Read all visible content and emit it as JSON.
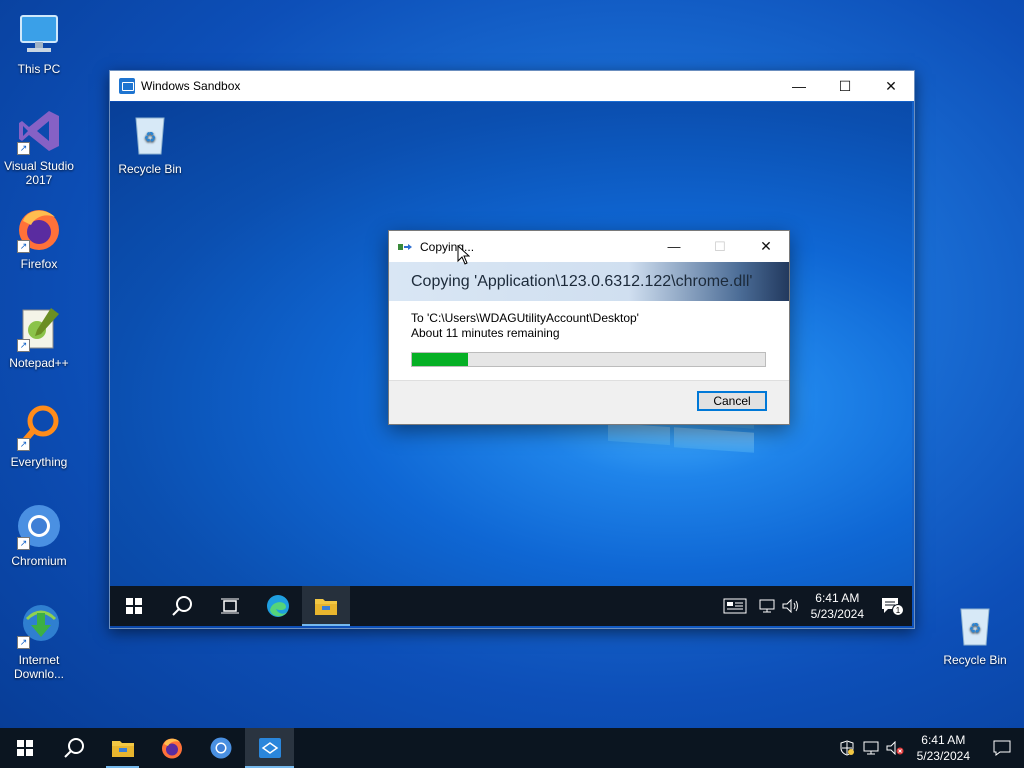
{
  "desktop": {
    "icons": [
      {
        "label": "This PC",
        "icon": "computer-icon"
      },
      {
        "label": "Visual Studio 2017",
        "icon": "visual-studio-icon"
      },
      {
        "label": "Firefox",
        "icon": "firefox-icon"
      },
      {
        "label": "Notepad++",
        "icon": "notepadpp-icon"
      },
      {
        "label": "Everything",
        "icon": "everything-search-icon"
      },
      {
        "label": "Chromium",
        "icon": "chromium-icon"
      },
      {
        "label": "Internet Downlo...",
        "icon": "idm-icon"
      },
      {
        "label": "Recycle Bin",
        "icon": "recycle-bin-icon"
      }
    ]
  },
  "sandbox": {
    "title": "Windows Sandbox",
    "desktop_icon_label": "Recycle Bin",
    "clock_time": "6:41 AM",
    "clock_date": "5/23/2024",
    "notification_count": "1"
  },
  "dialog": {
    "title": "Copying...",
    "heading": "Copying 'Application\\123.0.6312.122\\chrome.dll'",
    "to_line": "To 'C:\\Users\\WDAGUtilityAccount\\Desktop'",
    "time_remaining": "About 11 minutes remaining",
    "progress_percent": 16,
    "cancel_label": "Cancel"
  },
  "taskbar": {
    "clock_time": "6:41 AM",
    "clock_date": "5/23/2024"
  },
  "colors": {
    "progress": "#06b025",
    "accent": "#0078d7"
  }
}
